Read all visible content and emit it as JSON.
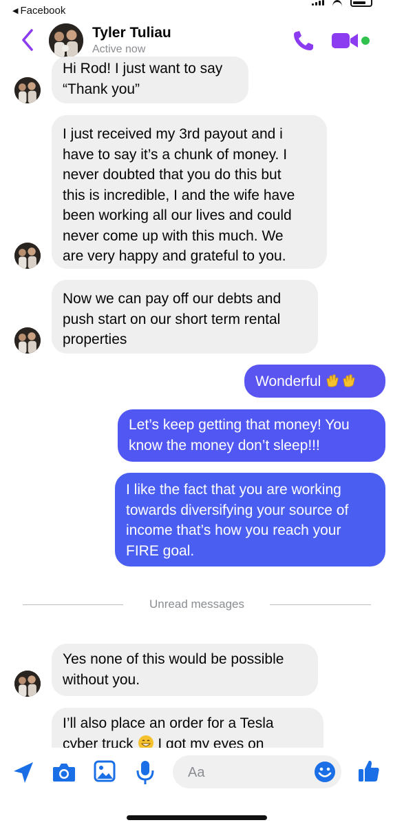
{
  "status_bar": {
    "back_app": "Facebook",
    "back_arrow": "◀"
  },
  "header": {
    "contact_name": "Tyler Tuliau",
    "status": "Active now",
    "icons": [
      "back-chevron-icon",
      "phone-icon",
      "video-camera-icon",
      "online-dot"
    ]
  },
  "colors": {
    "accent": "#8b3bf0",
    "outgoing_bubble_top": "#4d5ff2",
    "outgoing_bubble_bottom": "#535bf3",
    "composer_icons": "#1a6fe6",
    "incoming_bubble": "#efefef",
    "online": "#31c24d"
  },
  "messages": [
    {
      "dir": "in",
      "text_lines": [
        "Hi Rod! I just want to say",
        "“Thank you”"
      ]
    },
    {
      "dir": "in",
      "text_lines": [
        "I just received my 3rd payout and i",
        "have to say it’s a chunk of money. I",
        "never doubted that you do this but",
        "this is incredible, I and the wife have",
        "been working all our lives and could",
        "never come up with this much. We",
        "are very happy and grateful to you."
      ]
    },
    {
      "dir": "in",
      "text_lines": [
        "Now we can pay off our debts and",
        "push start on our short term rental",
        "properties"
      ]
    },
    {
      "dir": "out",
      "text": "Wonderful",
      "emoji": [
        "clapping-hands",
        "clapping-hands"
      ]
    },
    {
      "dir": "out",
      "text_lines": [
        "Let’s keep getting that money! You",
        "know the money don’t sleep!!!"
      ]
    },
    {
      "dir": "out",
      "text_lines": [
        "I like the fact that you are working",
        "towards diversifying your source of",
        "income that’s how you reach your",
        "FIRE goal."
      ]
    },
    {
      "dir": "in",
      "text_lines": [
        "Yes none of this would be possible",
        "without you."
      ]
    },
    {
      "dir": "in",
      "text_lines": [
        "I’ll also place an order for a Tesla",
        "cyber truck",
        "I got my eyes on"
      ],
      "emoji": [
        "grinning-face"
      ]
    }
  ],
  "divider": {
    "label": "Unread messages"
  },
  "composer": {
    "placeholder": "Aa",
    "icons": [
      "location-arrow-icon",
      "camera-icon",
      "gallery-icon",
      "microphone-icon",
      "emoji-icon",
      "thumbs-up-icon"
    ]
  }
}
